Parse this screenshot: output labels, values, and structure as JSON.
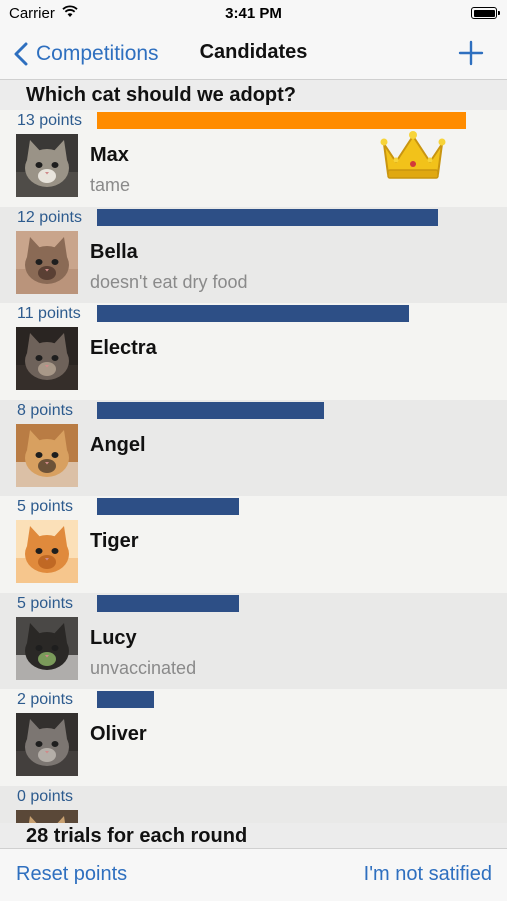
{
  "status_bar": {
    "carrier": "Carrier",
    "time": "3:41 PM"
  },
  "nav": {
    "back_label": "Competitions",
    "title": "Candidates",
    "add_icon": "plus-icon"
  },
  "question": "Which cat should we adopt?",
  "colors": {
    "leader_bar": "#ff8c00",
    "bar": "#2d4f86",
    "accent": "#2e6fbf",
    "points_text": "#2d5b8e"
  },
  "max_points": 13,
  "candidates": [
    {
      "points_label": "13 points",
      "points": 13,
      "name": "Max",
      "note": "tame",
      "leader": true,
      "photo": "tabby-kitten-photo"
    },
    {
      "points_label": "12 points",
      "points": 12,
      "name": "Bella",
      "note": "doesn't eat dry food",
      "leader": false,
      "photo": "brown-cat-photo"
    },
    {
      "points_label": "11 points",
      "points": 11,
      "name": "Electra",
      "note": "",
      "leader": false,
      "photo": "dark-tabby-photo"
    },
    {
      "points_label": "8 points",
      "points": 8,
      "name": "Angel",
      "note": "",
      "leader": false,
      "photo": "calico-cat-photo"
    },
    {
      "points_label": "5 points",
      "points": 5,
      "name": "Tiger",
      "note": "",
      "leader": false,
      "photo": "orange-cat-photo"
    },
    {
      "points_label": "5 points",
      "points": 5,
      "name": "Lucy",
      "note": "unvaccinated",
      "leader": false,
      "photo": "tuxedo-cat-photo"
    },
    {
      "points_label": "2 points",
      "points": 2,
      "name": "Oliver",
      "note": "",
      "leader": false,
      "photo": "grey-kitten-photo"
    },
    {
      "points_label": "0 points",
      "points": 0,
      "name": "",
      "note": "",
      "leader": false,
      "photo": "partial-cat-photo"
    }
  ],
  "footer_note": "28 trials for each round",
  "toolbar": {
    "reset_label": "Reset points",
    "not_satisfied_label": "I'm not satified"
  }
}
